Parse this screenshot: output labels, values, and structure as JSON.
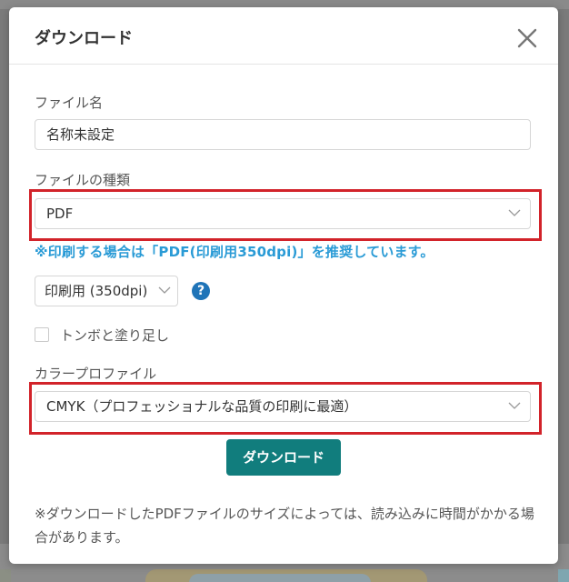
{
  "dialog": {
    "title": "ダウンロード"
  },
  "file_name": {
    "label": "ファイル名",
    "value": "名称未設定"
  },
  "file_type": {
    "label": "ファイルの種類",
    "selected": "PDF"
  },
  "print_note": "※印刷する場合は「PDF(印刷用350dpi)」を推奨しています。",
  "resolution": {
    "selected": "印刷用 (350dpi)"
  },
  "trim_marks": {
    "label": "トンボと塗り足し",
    "checked": false
  },
  "color_profile": {
    "label": "カラープロファイル",
    "selected": "CMYK（プロフェッショナルな品質の印刷に最適）"
  },
  "download_button": "ダウンロード",
  "footer_note": "※ダウンロードしたPDFファイルのサイズによっては、読み込みに時間がかかる場合があります。",
  "colors": {
    "accent": "#117d7d",
    "note": "#2a9bd6",
    "highlight": "#d2232a",
    "help": "#1f74b8"
  }
}
